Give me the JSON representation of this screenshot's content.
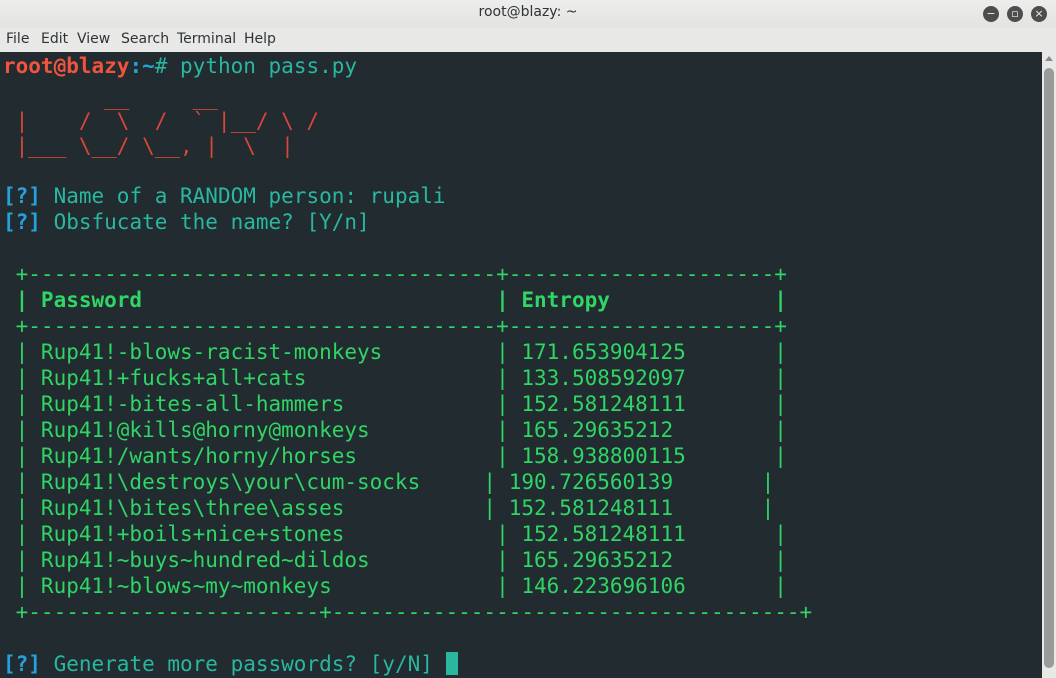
{
  "window": {
    "title": "root@blazy: ~",
    "buttons": {
      "minimize": "−",
      "maximize": "▫",
      "close": "×"
    }
  },
  "menu": [
    "File",
    "Edit",
    "View",
    "Search",
    "Terminal",
    "Help"
  ],
  "terminal": {
    "prompt": {
      "user_host": "root@blazy",
      "path": ":~",
      "symbol": "# ",
      "command": "python pass.py"
    },
    "ascii_art": [
      "        __     __",
      " |    /  \\  /  ` |__/ \\ /",
      " |___ \\__/ \\__, |  \\  |"
    ],
    "questions": [
      {
        "tag": "[?]",
        "text": " Name of a RANDOM person: rupali"
      },
      {
        "tag": "[?]",
        "text": " Obsfucate the name? [Y/n]"
      }
    ],
    "table": {
      "border_top": " +-------------------------------------+---------------------+",
      "header": " | Password                            | Entropy             |",
      "border_mid": " +-------------------------------------+---------------------+",
      "rows": [
        " | Rup41!-blows-racist-monkeys         | 171.653904125       |",
        " | Rup41!+fucks+all+cats               | 133.508592097       |",
        " | Rup41!-bites-all-hammers            | 152.581248111       |",
        " | Rup41!@kills@horny@monkeys          | 165.29635212        |",
        " | Rup41!/wants/horny/horses           | 158.938800115       |",
        " | Rup41!\\destroys\\your\\cum-socks     | 190.726560139       |",
        " | Rup41!\\bites\\three\\asses           | 152.581248111       |",
        " | Rup41!+boils+nice+stones            | 152.581248111       |",
        " | Rup41!~buys~hundred~dildos          | 165.29635212        |",
        " | Rup41!~blows~my~monkeys             | 146.223696106       |"
      ],
      "border_bottom": " +-----------------------+-------------------------------------+"
    },
    "final_prompt": {
      "tag": "[?]",
      "text": " Generate more passwords? [y/N] "
    }
  }
}
